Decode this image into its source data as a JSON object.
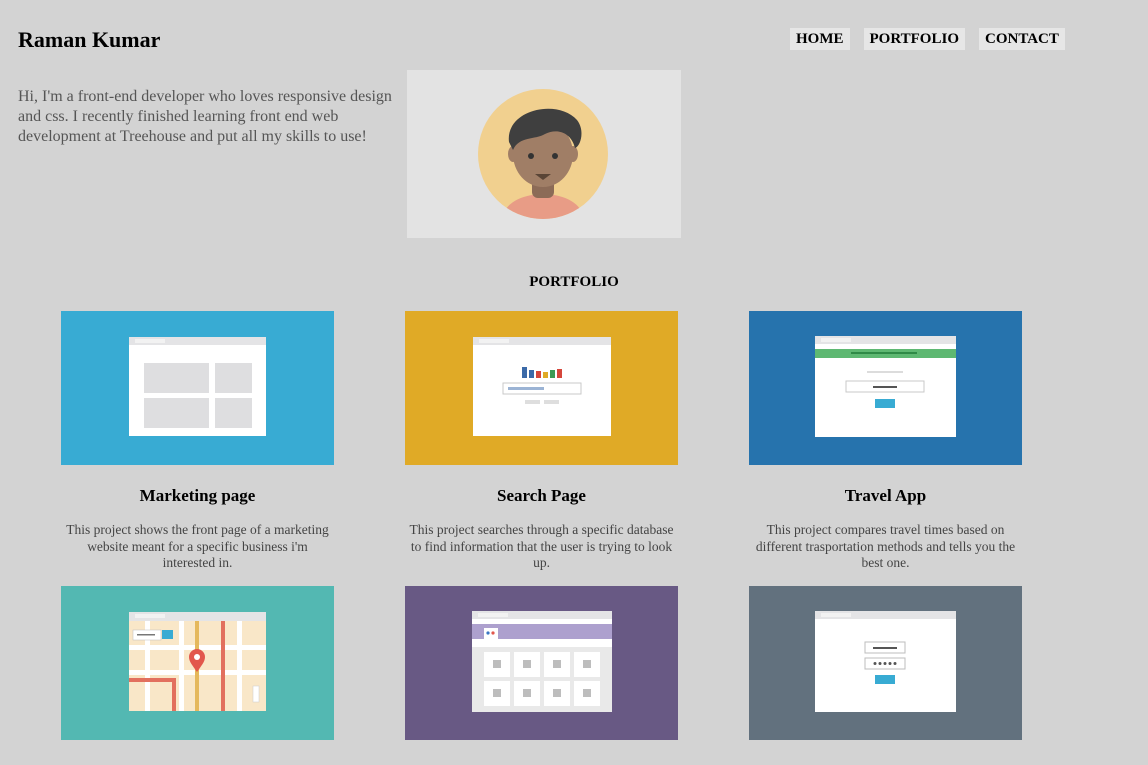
{
  "header": {
    "site_name": "Raman Kumar",
    "nav": [
      {
        "label": "HOME"
      },
      {
        "label": "PORTFOLIO"
      },
      {
        "label": "CONTACT"
      }
    ]
  },
  "intro": {
    "text": "Hi, I'm a front-end developer who loves responsive design and css. I recently finished learning front end web development at Treehouse and put all my skills to use!"
  },
  "portfolio": {
    "title": "PORTFOLIO",
    "projects": [
      {
        "title": "Marketing page",
        "description": "This project shows the front page of a marketing website meant for a specific business i'm interested in.",
        "color": "#38abd3"
      },
      {
        "title": "Search Page",
        "description": "This project searches through a specific database to find information that the user is trying to look up.",
        "color": "#e0aa26"
      },
      {
        "title": "Travel App",
        "description": "This project compares travel times based on different trasportation methods and tells you the best one.",
        "color": "#2673ad"
      },
      {
        "color": "#53b8b2"
      },
      {
        "color": "#685984"
      },
      {
        "color": "#62717e"
      }
    ]
  }
}
